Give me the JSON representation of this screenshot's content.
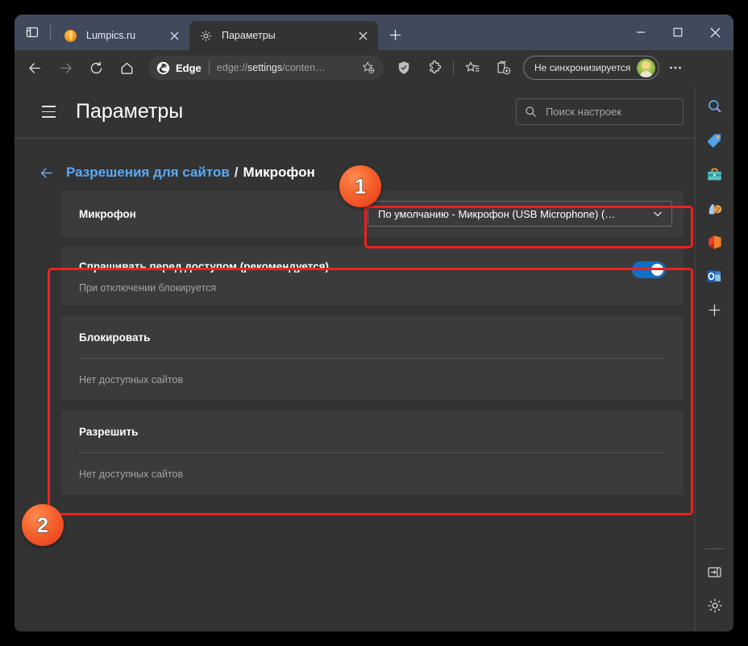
{
  "window": {
    "minimize_label": "minimize",
    "maximize_label": "maximize",
    "close_label": "close"
  },
  "tabs": {
    "tab_search_name": "tab-search",
    "newtab_label": "+",
    "items": [
      {
        "title": "Lumpics.ru",
        "favicon": "orange-circle-icon",
        "active": false
      },
      {
        "title": "Параметры",
        "favicon": "gear-icon",
        "active": true
      }
    ]
  },
  "toolbar": {
    "back_name": "back-icon",
    "forward_name": "forward-icon",
    "refresh_name": "refresh-icon",
    "home_name": "home-icon",
    "omnibox": {
      "brand": "Edge",
      "url_prefix": "edge://",
      "url_bold": "settings",
      "url_suffix": "/conten…",
      "favorite_icon": "star-add-icon"
    },
    "shield_icon": "shield-icon",
    "extensions_icon": "puzzle-icon",
    "favorites_icon": "favorites-star-list-icon",
    "collections_icon": "collections-icon",
    "profile": {
      "label": "Не синхронизируется",
      "avatar_name": "user-avatar"
    },
    "more_icon": "more-ellipsis-icon"
  },
  "settings": {
    "menu_icon": "hamburger-menu-icon",
    "title": "Параметры",
    "search": {
      "placeholder": "Поиск настроек",
      "icon": "search-icon"
    },
    "breadcrumb": {
      "back_icon": "back-arrow-icon",
      "parent": "Разрешения для сайтов",
      "separator": "/",
      "current": "Микрофон"
    },
    "device_row": {
      "label": "Микрофон",
      "select_value": "По умолчанию - Микрофон (USB Microphone) (…",
      "chevron_icon": "chevron-down-icon"
    },
    "ask_row": {
      "title": "Спрашивать перед доступом (рекомендуется)",
      "subtitle": "При отключении блокируется",
      "toggle_on": true
    },
    "block_section": {
      "title": "Блокировать",
      "empty_text": "Нет доступных сайтов"
    },
    "allow_section": {
      "title": "Разрешить",
      "empty_text": "Нет доступных сайтов"
    }
  },
  "sidebar": {
    "items": [
      {
        "name": "search-icon"
      },
      {
        "name": "shopping-tag-icon"
      },
      {
        "name": "tools-briefcase-icon"
      },
      {
        "name": "games-icon"
      },
      {
        "name": "office-icon"
      },
      {
        "name": "outlook-icon"
      },
      {
        "name": "add-icon",
        "label": "+"
      }
    ],
    "bottom": [
      {
        "name": "collapse-panel-icon"
      },
      {
        "name": "settings-gear-icon"
      }
    ]
  },
  "annotations": {
    "badges": [
      {
        "number": "1"
      },
      {
        "number": "2"
      }
    ],
    "highlight_color": "#ef2020"
  }
}
